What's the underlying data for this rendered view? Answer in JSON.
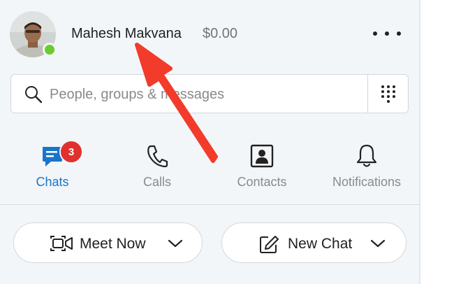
{
  "profile": {
    "name": "Mahesh Makvana",
    "balance": "$0.00",
    "status": "online"
  },
  "search": {
    "placeholder": "People, groups & messages"
  },
  "nav": [
    {
      "label": "Chats",
      "active": true,
      "badge": "3"
    },
    {
      "label": "Calls",
      "active": false
    },
    {
      "label": "Contacts",
      "active": false
    },
    {
      "label": "Notifications",
      "active": false
    }
  ],
  "actions": {
    "meet_now": "Meet Now",
    "new_chat": "New Chat"
  },
  "colors": {
    "accent": "#1a74c9",
    "badge": "#e0312d",
    "presence": "#6bcb2e",
    "annotation_arrow": "#f23b2a"
  },
  "icons": [
    "more-icon",
    "search-icon",
    "dialpad-icon",
    "chats-icon",
    "calls-icon",
    "contacts-icon",
    "notifications-icon",
    "video-icon",
    "compose-icon",
    "chevron-down-icon"
  ]
}
